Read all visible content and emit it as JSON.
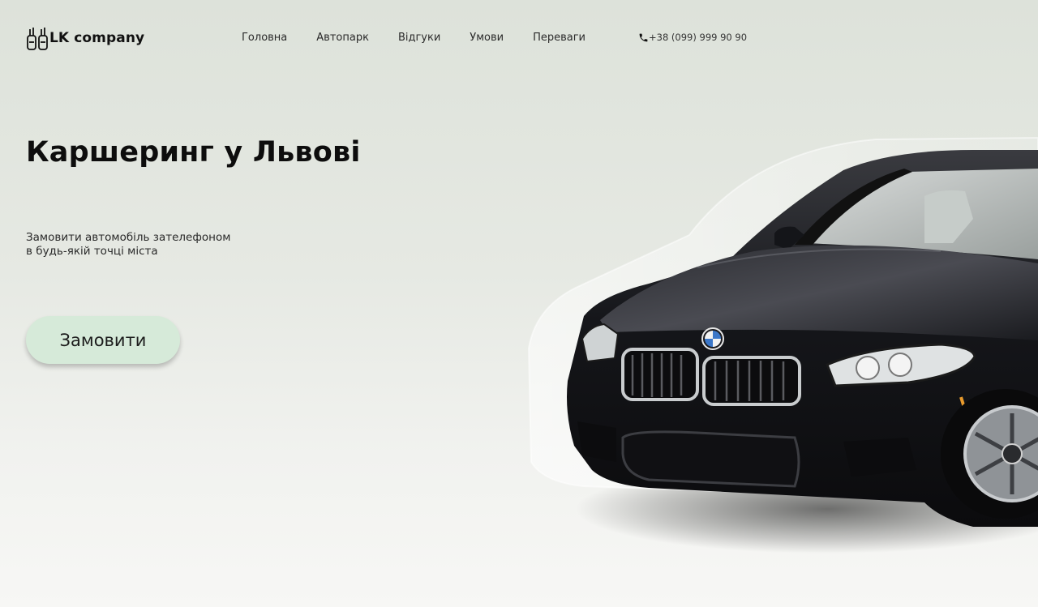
{
  "header": {
    "logo_text": "LK company",
    "nav": [
      {
        "label": "Головна"
      },
      {
        "label": "Автопарк"
      },
      {
        "label": "Відгуки"
      },
      {
        "label": "Умови"
      },
      {
        "label": "Переваги"
      }
    ],
    "phone": "+38 (099) 999 90 90"
  },
  "hero": {
    "title": "Каршеринг у Львові",
    "subtitle_lines": [
      "Замовити автомобіль зателефоном",
      "в будь-якій точці міста"
    ],
    "button_label": "Замовити"
  },
  "colors": {
    "button_bg": "#d6ead9",
    "text": "#111111",
    "bg_top": "#dde2da",
    "bg_bottom": "#f7f7f5"
  },
  "icons": {
    "logo": "car-keys-icon",
    "phone": "phone-icon",
    "hero_image": "black-sedan-car-image"
  }
}
